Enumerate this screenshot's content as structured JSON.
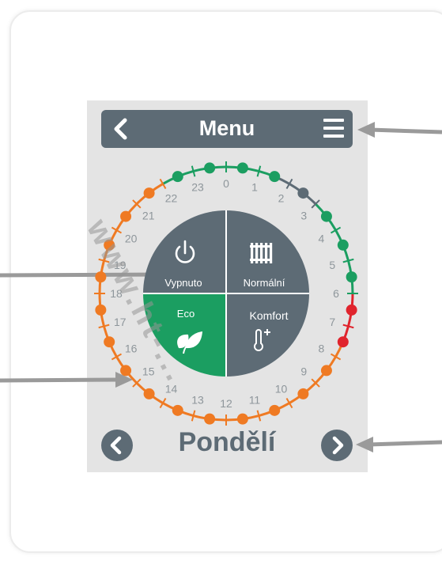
{
  "header": {
    "title": "Menu"
  },
  "modes": {
    "off": "Vypnuto",
    "normal": "Normální",
    "eco": "Eco",
    "comfort": "Komfort"
  },
  "day": {
    "label": "Pondělí"
  },
  "hours": [
    "0",
    "1",
    "2",
    "3",
    "4",
    "5",
    "6",
    "7",
    "8",
    "9",
    "10",
    "11",
    "12",
    "13",
    "14",
    "15",
    "16",
    "17",
    "18",
    "19",
    "20",
    "21",
    "22",
    "23"
  ],
  "schedule_colors": {
    "normal": "#1b9e61",
    "off": "#5d6b75",
    "comfort": "#e0242d",
    "eco": "#ef7a23"
  },
  "watermark": "www.ht-...",
  "colors": {
    "panel_bg": "#e4e4e4",
    "accent_dark": "#5d6b75",
    "eco_green": "#1b9e61"
  }
}
